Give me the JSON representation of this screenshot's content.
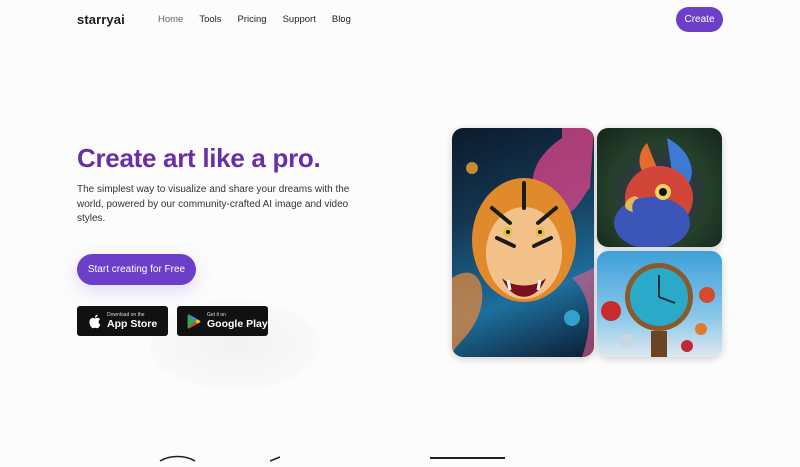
{
  "nav": {
    "logo": "starryai",
    "items": [
      {
        "label": "Home"
      },
      {
        "label": "Tools"
      },
      {
        "label": "Pricing"
      },
      {
        "label": "Support"
      },
      {
        "label": "Blog"
      }
    ],
    "create_label": "Create"
  },
  "hero": {
    "title": "Create art like a pro.",
    "subtitle": "The simplest way to visualize and share your dreams with the world, powered by our community-crafted AI image and video styles.",
    "cta_label": "Start creating for Free"
  },
  "stores": {
    "apple": {
      "small": "Download on the",
      "big": "App Store"
    },
    "google": {
      "small": "Get it on",
      "big": "Google Play"
    }
  },
  "colors": {
    "accent": "#6c3fc9",
    "title": "#6b2fa5"
  },
  "gallery": {
    "images": [
      "tiger-artwork",
      "bird-artwork",
      "clock-artwork"
    ]
  }
}
